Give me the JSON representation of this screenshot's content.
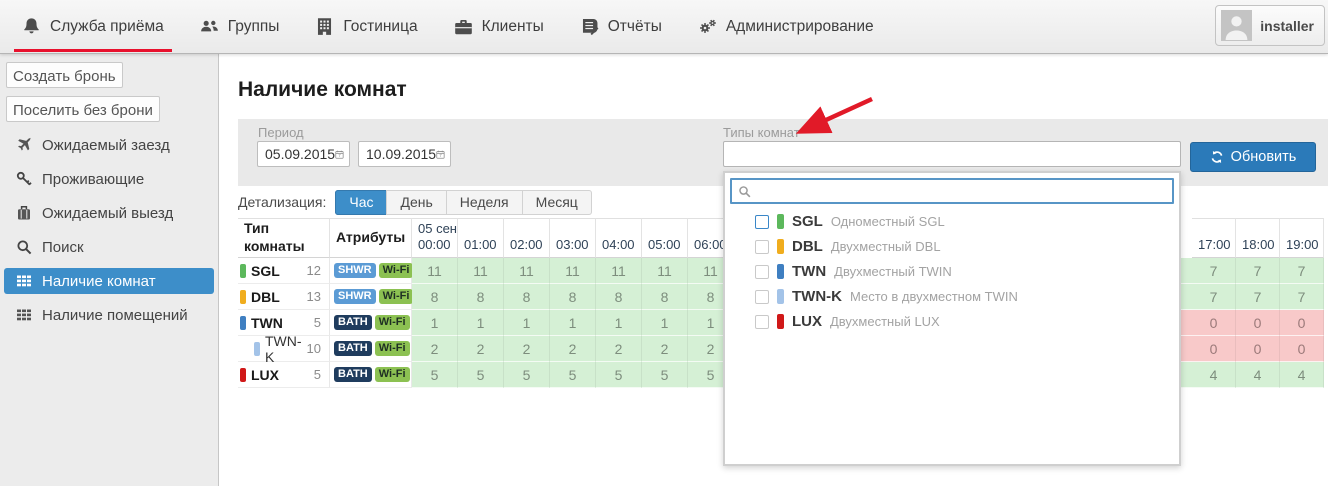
{
  "colors": {
    "accent_blue": "#3d8ec9",
    "refresh_button_blue": "#2b7ab9",
    "active_tab_underline_red": "#e8112d",
    "annotation_arrow_red": "#e11a28",
    "cell_available_green": "#d5f0d5",
    "cell_full_red": "#f8c9c9"
  },
  "topbar": {
    "items": [
      {
        "label": "Служба приёма",
        "icon": "bell",
        "active": true
      },
      {
        "label": "Группы",
        "icon": "users",
        "active": false
      },
      {
        "label": "Гостиница",
        "icon": "building",
        "active": false
      },
      {
        "label": "Клиенты",
        "icon": "briefcase",
        "active": false
      },
      {
        "label": "Отчёты",
        "icon": "book",
        "active": false
      },
      {
        "label": "Администрирование",
        "icon": "gears",
        "active": false
      }
    ],
    "user": {
      "name": "installer"
    }
  },
  "sidebar": {
    "buttons": [
      {
        "label": "Создать бронь"
      },
      {
        "label": "Поселить без брони"
      }
    ],
    "items": [
      {
        "label": "Ожидаемый заезд",
        "icon": "plane",
        "active": false
      },
      {
        "label": "Проживающие",
        "icon": "key",
        "active": false
      },
      {
        "label": "Ожидаемый выезд",
        "icon": "luggage",
        "active": false
      },
      {
        "label": "Поиск",
        "icon": "search",
        "active": false
      },
      {
        "label": "Наличие комнат",
        "icon": "grid",
        "active": true
      },
      {
        "label": "Наличие помещений",
        "icon": "grid",
        "active": false
      }
    ]
  },
  "main": {
    "title": "Наличие комнат",
    "filter": {
      "period_label": "Период",
      "date_from": "05.09.2015",
      "date_to": "10.09.2015",
      "room_types_label": "Типы комнат",
      "room_types_value": "",
      "refresh_label": "Обновить"
    },
    "detalization": {
      "label": "Детализация:",
      "tabs": [
        {
          "label": "Час",
          "active": true
        },
        {
          "label": "День",
          "active": false
        },
        {
          "label": "Неделя",
          "active": false
        },
        {
          "label": "Месяц",
          "active": false
        }
      ]
    }
  },
  "table": {
    "columns": {
      "type": "Тип комнаты",
      "attrs": "Атрибуты"
    },
    "left_hours": [
      {
        "date": "05 сен",
        "time": "00:00"
      },
      {
        "time": "01:00"
      },
      {
        "time": "02:00"
      },
      {
        "time": "03:00"
      },
      {
        "time": "04:00"
      },
      {
        "time": "05:00"
      },
      {
        "time": "06:00"
      }
    ],
    "right_hours": [
      {
        "time": "17:00"
      },
      {
        "time": "18:00"
      },
      {
        "time": "19:00"
      }
    ],
    "badge_colors": {
      "SHWR": {
        "bg": "#5b9bd5",
        "fg": "#ffffff"
      },
      "BATH": {
        "bg": "#1f3c5e",
        "fg": "#ffffff"
      },
      "Wi-Fi": {
        "bg": "#8cc152",
        "fg": "#1e2f23"
      }
    },
    "rows": [
      {
        "code": "SGL",
        "pill_color": "#5cb85c",
        "count": "12",
        "indent": false,
        "attrs": [
          "SHWR",
          "Wi-Fi"
        ],
        "left_values": [
          11,
          11,
          11,
          11,
          11,
          11,
          11
        ],
        "right_values": [
          7,
          7,
          7
        ],
        "right_status": "available"
      },
      {
        "code": "DBL",
        "pill_color": "#f0ad1e",
        "count": "13",
        "indent": false,
        "attrs": [
          "SHWR",
          "Wi-Fi"
        ],
        "left_values": [
          8,
          8,
          8,
          8,
          8,
          8,
          8
        ],
        "right_values": [
          7,
          7,
          7
        ],
        "right_status": "available"
      },
      {
        "code": "TWN",
        "pill_color": "#3f7fc1",
        "count": "5",
        "indent": false,
        "attrs": [
          "BATH",
          "Wi-Fi"
        ],
        "left_values": [
          1,
          1,
          1,
          1,
          1,
          1,
          1
        ],
        "right_values": [
          0,
          0,
          0
        ],
        "right_status": "full"
      },
      {
        "code": "TWN-K",
        "pill_color": "#a3c3e8",
        "count": "10",
        "indent": true,
        "attrs": [
          "BATH",
          "Wi-Fi"
        ],
        "left_values": [
          2,
          2,
          2,
          2,
          2,
          2,
          2
        ],
        "right_values": [
          0,
          0,
          0
        ],
        "right_status": "full"
      },
      {
        "code": "LUX",
        "pill_color": "#d01818",
        "count": "5",
        "indent": false,
        "attrs": [
          "BATH",
          "Wi-Fi"
        ],
        "left_values": [
          5,
          5,
          5,
          5,
          5,
          5,
          5
        ],
        "right_values": [
          4,
          4,
          4
        ],
        "right_status": "available"
      }
    ]
  },
  "dropdown": {
    "search_value": "",
    "items": [
      {
        "code": "SGL",
        "pill_color": "#5cb85c",
        "desc": "Одноместный SGL",
        "checked": false,
        "focused": true
      },
      {
        "code": "DBL",
        "pill_color": "#f0ad1e",
        "desc": "Двухместный DBL",
        "checked": false,
        "focused": false
      },
      {
        "code": "TWN",
        "pill_color": "#3f7fc1",
        "desc": "Двухместный TWIN",
        "checked": false,
        "focused": false
      },
      {
        "code": "TWN-K",
        "pill_color": "#a3c3e8",
        "desc": "Место в двухместном TWIN",
        "checked": false,
        "focused": false
      },
      {
        "code": "LUX",
        "pill_color": "#d01818",
        "desc": "Двухместный LUX",
        "checked": false,
        "focused": false
      }
    ]
  }
}
